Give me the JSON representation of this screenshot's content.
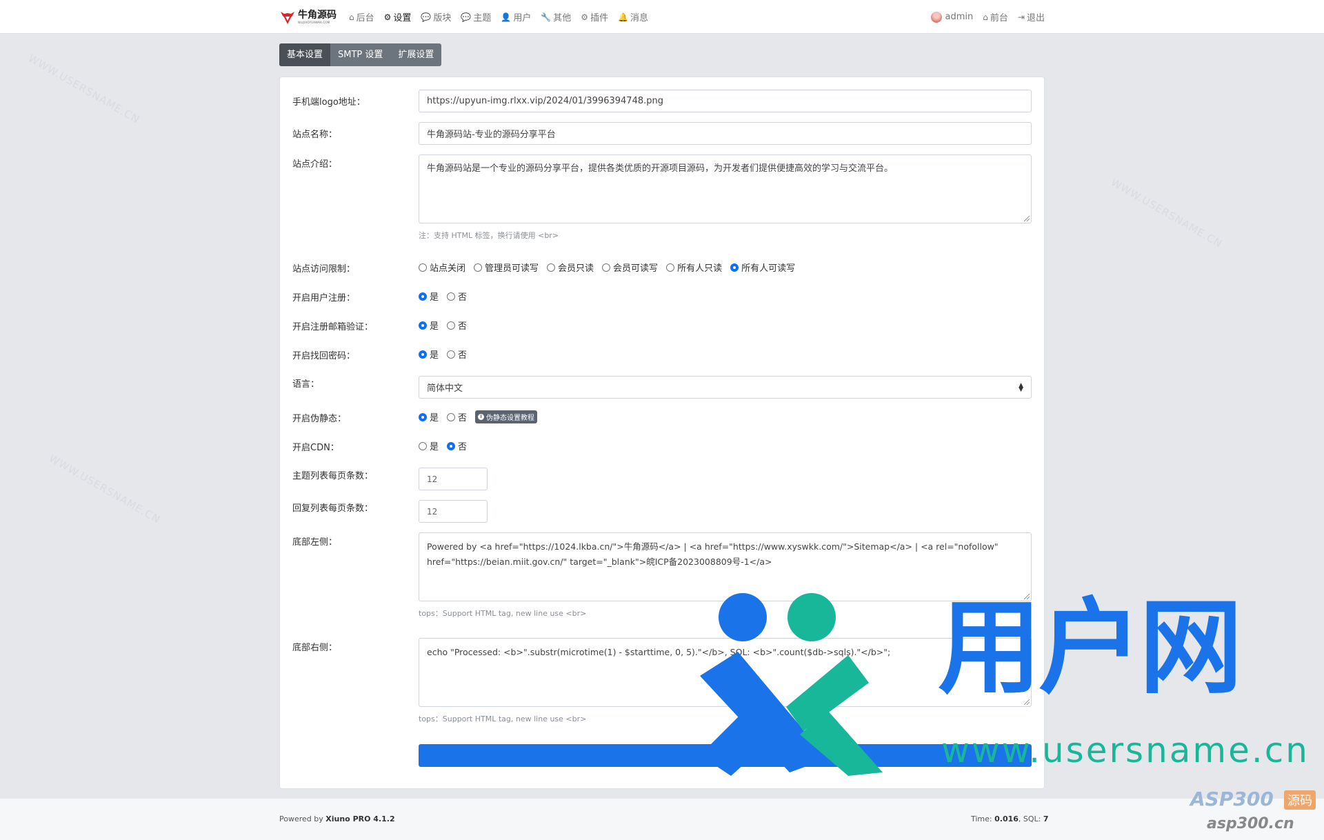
{
  "header": {
    "logo_title": "牛角源码",
    "logo_sub": "NIUJIAOYUANMA.COM",
    "nav": [
      {
        "label": "后台",
        "icon": "home-icon",
        "glyph": "⌂"
      },
      {
        "label": "设置",
        "icon": "gear-icon",
        "glyph": "⚙",
        "active": true
      },
      {
        "label": "版块",
        "icon": "comments-icon",
        "glyph": "💬"
      },
      {
        "label": "主题",
        "icon": "comment-icon",
        "glyph": "💬"
      },
      {
        "label": "用户",
        "icon": "user-icon",
        "glyph": "👤"
      },
      {
        "label": "其他",
        "icon": "wrench-icon",
        "glyph": "🔧"
      },
      {
        "label": "插件",
        "icon": "cogs-icon",
        "glyph": "⚙"
      },
      {
        "label": "消息",
        "icon": "bell-icon",
        "glyph": "🔔"
      }
    ],
    "user": "admin",
    "frontend": "前台",
    "logout": "退出"
  },
  "tabs": [
    {
      "label": "基本设置",
      "active": true
    },
    {
      "label": "SMTP 设置"
    },
    {
      "label": "扩展设置"
    }
  ],
  "form": {
    "mobile_logo": {
      "label": "手机端logo地址：",
      "value": "https://upyun-img.rlxx.vip/2024/01/3996394748.png"
    },
    "site_name": {
      "label": "站点名称：",
      "value": "牛角源码站-专业的源码分享平台"
    },
    "site_intro": {
      "label": "站点介绍：",
      "value": "牛角源码站是一个专业的源码分享平台，提供各类优质的开源项目源码，为开发者们提供便捷高效的学习与交流平台。",
      "hint": "注：支持 HTML 标签，换行请使用 <br>"
    },
    "access": {
      "label": "站点访问限制：",
      "options": [
        "站点关闭",
        "管理员可读写",
        "会员只读",
        "会员可读写",
        "所有人只读",
        "所有人可读写"
      ],
      "selected": 5
    },
    "user_register": {
      "label": "开启用户注册：",
      "options": [
        "是",
        "否"
      ],
      "selected": 0
    },
    "email_verify": {
      "label": "开启注册邮箱验证：",
      "options": [
        "是",
        "否"
      ],
      "selected": 0
    },
    "find_password": {
      "label": "开启找回密码：",
      "options": [
        "是",
        "否"
      ],
      "selected": 0
    },
    "language": {
      "label": "语言：",
      "value": "简体中文"
    },
    "rewrite": {
      "label": "开启伪静态：",
      "options": [
        "是",
        "否"
      ],
      "selected": 0,
      "badge": "伪静态设置教程"
    },
    "cdn": {
      "label": "开启CDN：",
      "options": [
        "是",
        "否"
      ],
      "selected": 1
    },
    "thread_pagesize": {
      "label": "主题列表每页条数：",
      "value": "12"
    },
    "post_pagesize": {
      "label": "回复列表每页条数：",
      "value": "12"
    },
    "footer_left": {
      "label": "底部左侧：",
      "value": "Powered by <a href=\"https://1024.lkba.cn/\">牛角源码</a> | <a href=\"https://www.xyswkk.com/\">Sitemap</a> | <a rel=\"nofollow\" href=\"https://beian.miit.gov.cn/\" target=\"_blank\">皖ICP备2023008809号-1</a>",
      "hint": "tops：Support HTML tag, new line use <br>"
    },
    "footer_right": {
      "label": "底部右侧：",
      "value": "echo \"Processed: <b>\".substr(microtime(1) - $starttime, 0, 5).\"</b>, SQL: <b>\".count($db->sqls).\"</b>\";",
      "hint": "tops：Support HTML tag, new line use <br>"
    },
    "submit": "确定"
  },
  "footer": {
    "powered_prefix": "Powered by ",
    "powered_name": "Xiuno PRO 4.1.2",
    "time_prefix": "Time: ",
    "time_value": "0.016",
    "sql_prefix": ", SQL: ",
    "sql_value": "7"
  },
  "watermark": {
    "cn": "用户网",
    "url": "www.usersname.cn",
    "small": "WWW.USERSNAME.CN",
    "asp_brand": "ASP300",
    "asp_tag": "源码",
    "asp_url": "asp300.cn"
  }
}
